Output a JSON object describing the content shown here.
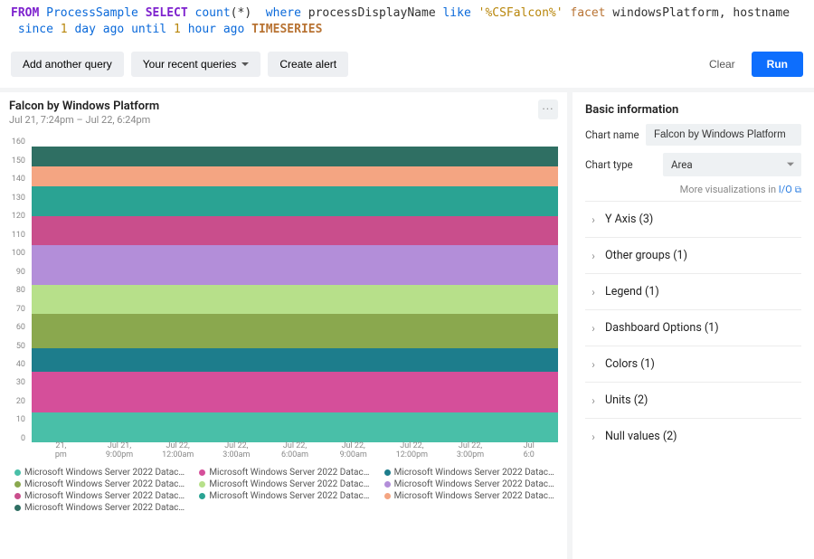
{
  "query": {
    "tokens": [
      {
        "t": "FROM",
        "c": "kw-from"
      },
      {
        "t": " ",
        "c": "kw-plain"
      },
      {
        "t": "ProcessSample",
        "c": "kw-ident"
      },
      {
        "t": " ",
        "c": "kw-plain"
      },
      {
        "t": "SELECT",
        "c": "kw-sel"
      },
      {
        "t": " ",
        "c": "kw-plain"
      },
      {
        "t": "count",
        "c": "kw-func"
      },
      {
        "t": "(",
        "c": "kw-plain"
      },
      {
        "t": "*",
        "c": "kw-plain"
      },
      {
        "t": ")",
        "c": "kw-plain"
      },
      {
        "t": "  ",
        "c": "kw-plain"
      },
      {
        "t": "where",
        "c": "kw-where"
      },
      {
        "t": " ",
        "c": "kw-plain"
      },
      {
        "t": "processDisplayName",
        "c": "kw-plain"
      },
      {
        "t": " ",
        "c": "kw-plain"
      },
      {
        "t": "like",
        "c": "kw-blue"
      },
      {
        "t": " ",
        "c": "kw-plain"
      },
      {
        "t": "'%CSFalcon%'",
        "c": "kw-str"
      },
      {
        "t": " ",
        "c": "kw-plain"
      },
      {
        "t": "facet",
        "c": "kw-facet"
      },
      {
        "t": " ",
        "c": "kw-plain"
      },
      {
        "t": "windowsPlatform",
        "c": "kw-plain"
      },
      {
        "t": ", ",
        "c": "kw-plain"
      },
      {
        "t": "hostname",
        "c": "kw-plain"
      },
      {
        "t": "\n ",
        "c": "kw-plain"
      },
      {
        "t": "since",
        "c": "kw-blue"
      },
      {
        "t": " ",
        "c": "kw-plain"
      },
      {
        "t": "1",
        "c": "kw-num"
      },
      {
        "t": " ",
        "c": "kw-plain"
      },
      {
        "t": "day",
        "c": "kw-blue"
      },
      {
        "t": " ",
        "c": "kw-plain"
      },
      {
        "t": "ago",
        "c": "kw-blue"
      },
      {
        "t": " ",
        "c": "kw-plain"
      },
      {
        "t": "until",
        "c": "kw-blue"
      },
      {
        "t": " ",
        "c": "kw-plain"
      },
      {
        "t": "1",
        "c": "kw-num"
      },
      {
        "t": " ",
        "c": "kw-plain"
      },
      {
        "t": "hour",
        "c": "kw-blue"
      },
      {
        "t": " ",
        "c": "kw-plain"
      },
      {
        "t": "ago",
        "c": "kw-blue"
      },
      {
        "t": " ",
        "c": "kw-plain"
      },
      {
        "t": "TIMESERIES",
        "c": "kw-ts"
      }
    ]
  },
  "toolbar": {
    "add_query": "Add another query",
    "recent": "Your recent queries",
    "create_alert": "Create alert",
    "clear": "Clear",
    "run": "Run"
  },
  "chart": {
    "title": "Falcon by Windows Platform",
    "subtitle": "Jul 21, 7:24pm – Jul 22, 6:24pm",
    "menu": "···"
  },
  "chart_data": {
    "type": "area",
    "title": "Falcon by Windows Platform",
    "xlabel": "",
    "ylabel": "",
    "ylim": [
      0,
      160
    ],
    "y_ticks": [
      160,
      150,
      140,
      130,
      120,
      110,
      100,
      90,
      80,
      70,
      60,
      50,
      40,
      30,
      20,
      10,
      0
    ],
    "x_ticks": [
      {
        "l1": "21,",
        "l2": "pm"
      },
      {
        "l1": "Jul 21,",
        "l2": "9:00pm"
      },
      {
        "l1": "Jul 22,",
        "l2": "12:00am"
      },
      {
        "l1": "Jul 22,",
        "l2": "3:00am"
      },
      {
        "l1": "Jul 22,",
        "l2": "6:00am"
      },
      {
        "l1": "Jul 22,",
        "l2": "9:00am"
      },
      {
        "l1": "Jul 22,",
        "l2": "12:00pm"
      },
      {
        "l1": "Jul 22,",
        "l2": "3:00pm"
      },
      {
        "l1": "Jul",
        "l2": "6:0"
      }
    ],
    "series": [
      {
        "name": "Microsoft Windows Server 2022 Datacenter,…",
        "color": "#2f6f63",
        "band_top": 150,
        "band_bottom": 140,
        "constant": 10
      },
      {
        "name": "Microsoft Windows Server 2022 Datacenter,…",
        "color": "#f4a582",
        "band_top": 140,
        "band_bottom": 130,
        "constant": 10
      },
      {
        "name": "Microsoft Windows Server 2022 Datacenter,…",
        "color": "#2aa393",
        "band_top": 130,
        "band_bottom": 115,
        "constant": 15
      },
      {
        "name": "Microsoft Windows Server 2022 Datacenter,…",
        "color": "#c94e8c",
        "band_top": 115,
        "band_bottom": 100,
        "constant": 15
      },
      {
        "name": "Microsoft Windows Server 2022 Datacenter,…",
        "color": "#b38ed9",
        "band_top": 100,
        "band_bottom": 80,
        "constant": 20
      },
      {
        "name": "Microsoft Windows Server 2022 Datacenter,…",
        "color": "#b7e08a",
        "band_top": 80,
        "band_bottom": 65,
        "constant": 15
      },
      {
        "name": "Microsoft Windows Server 2022 Datacenter,…",
        "color": "#8aa84e",
        "band_top": 65,
        "band_bottom": 48,
        "constant": 17
      },
      {
        "name": "Microsoft Windows Server 2022 Datacenter,…",
        "color": "#1d7d8c",
        "band_top": 48,
        "band_bottom": 36,
        "constant": 12
      },
      {
        "name": "Microsoft Windows Server 2022 Datacenter,…",
        "color": "#d54f9a",
        "band_top": 36,
        "band_bottom": 15,
        "constant": 21
      },
      {
        "name": "Microsoft Windows Server 2022 Datacenter,…",
        "color": "#49bfa8",
        "band_top": 15,
        "band_bottom": 0,
        "constant": 15
      }
    ],
    "bands": [
      {
        "color": "#2f6f63",
        "weight": 1.0
      },
      {
        "color": "#f4a582",
        "weight": 1.0
      },
      {
        "color": "#2aa393",
        "weight": 1.5
      },
      {
        "color": "#c94e8c",
        "weight": 1.5
      },
      {
        "color": "#b38ed9",
        "weight": 2.0
      },
      {
        "color": "#b7e08a",
        "weight": 1.5
      },
      {
        "color": "#8aa84e",
        "weight": 1.7
      },
      {
        "color": "#1d7d8c",
        "weight": 1.2
      },
      {
        "color": "#d54f9a",
        "weight": 2.1
      },
      {
        "color": "#49bfa8",
        "weight": 1.5
      }
    ],
    "legend": [
      {
        "color": "#49bfa8",
        "text": "Microsoft Windows Server 2022 Datacenter,…"
      },
      {
        "color": "#d54f9a",
        "text": "Microsoft Windows Server 2022 Datacenter,…"
      },
      {
        "color": "#1d7d8c",
        "text": "Microsoft Windows Server 2022 Datacenter,…"
      },
      {
        "color": "#8aa84e",
        "text": "Microsoft Windows Server 2022 Datacenter,…"
      },
      {
        "color": "#b7e08a",
        "text": "Microsoft Windows Server 2022 Datacenter,…"
      },
      {
        "color": "#b38ed9",
        "text": "Microsoft Windows Server 2022 Datacenter,…"
      },
      {
        "color": "#c94e8c",
        "text": "Microsoft Windows Server 2022 Datacenter,…"
      },
      {
        "color": "#2aa393",
        "text": "Microsoft Windows Server 2022 Datacenter,…"
      },
      {
        "color": "#f4a582",
        "text": "Microsoft Windows Server 2022 Datacenter,…"
      },
      {
        "color": "#2f6f63",
        "text": "Microsoft Windows Server 2022 Datacenter,…"
      }
    ]
  },
  "sidebar": {
    "basic_info": "Basic information",
    "chart_name_label": "Chart name",
    "chart_name_value": "Falcon by Windows Platform",
    "chart_type_label": "Chart type",
    "chart_type_value": "Area",
    "more_visualizations": "More visualizations in ",
    "more_visualizations_link": "I/O",
    "accordion": [
      {
        "label": "Y Axis (3)"
      },
      {
        "label": "Other groups (1)"
      },
      {
        "label": "Legend (1)"
      },
      {
        "label": "Dashboard Options (1)"
      },
      {
        "label": "Colors (1)"
      },
      {
        "label": "Units (2)"
      },
      {
        "label": "Null values (2)"
      }
    ]
  }
}
